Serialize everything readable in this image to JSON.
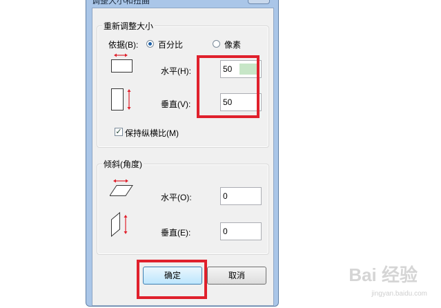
{
  "dialog": {
    "title": "调整大小和扭曲",
    "close_label": "✕"
  },
  "resize": {
    "group_title": "重新调整大小",
    "basis_label": "依据(B):",
    "percent_label": "百分比",
    "pixels_label": "像素",
    "horizontal_label": "水平(H):",
    "horizontal_value": "50",
    "vertical_label": "垂直(V):",
    "vertical_value": "50",
    "keep_ratio_label": "保持纵横比(M)",
    "keep_ratio_checked": "✓"
  },
  "skew": {
    "group_title": "倾斜(角度)",
    "horizontal_label": "水平(O):",
    "horizontal_value": "0",
    "vertical_label": "垂直(E):",
    "vertical_value": "0"
  },
  "buttons": {
    "ok_label": "确定",
    "cancel_label": "取消"
  },
  "watermark": {
    "text": "Bai 经验",
    "sub": "jingyan.baidu.com"
  },
  "colors": {
    "highlight": "#e0202c",
    "selection": "#c7e6c7"
  }
}
